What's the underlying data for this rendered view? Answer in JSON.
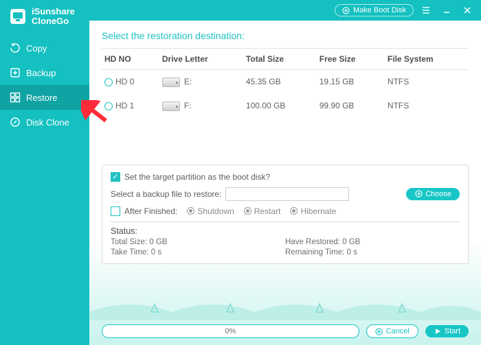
{
  "brand": {
    "line1": "iSunshare",
    "line2": "CloneGo"
  },
  "nav": {
    "copy": "Copy",
    "backup": "Backup",
    "restore": "Restore",
    "diskclone": "Disk Clone"
  },
  "titlebar": {
    "make_boot_disk": "Make Boot Disk"
  },
  "heading": "Select the restoration destination:",
  "table": {
    "headers": {
      "hdno": "HD NO",
      "letter": "Drive Letter",
      "total": "Total Size",
      "free": "Free Size",
      "fs": "File System"
    },
    "rows": [
      {
        "hdno": "HD 0",
        "letter": "E:",
        "total": "45.35 GB",
        "free": "19.15 GB",
        "fs": "NTFS"
      },
      {
        "hdno": "HD 1",
        "letter": "F:",
        "total": "100.00 GB",
        "free": "99.90 GB",
        "fs": "NTFS"
      }
    ]
  },
  "panel": {
    "target_boot_label": "Set the target partition as the boot disk?",
    "select_backup_label": "Select a backup file to restore:",
    "backup_path": "",
    "choose_label": "Choose",
    "after_finished_label": "After Finished:",
    "opts": {
      "shutdown": "Shutdown",
      "restart": "Restart",
      "hibernate": "Hibernate"
    },
    "status_title": "Status:",
    "total_size": "Total Size: 0 GB",
    "have_restored": "Have Restored: 0 GB",
    "take_time": "Take Time: 0 s",
    "remaining_time": "Remaining Time: 0 s"
  },
  "footer": {
    "progress_text": "0%",
    "cancel": "Cancel",
    "start": "Start"
  },
  "colors": {
    "accent": "#14c0c0"
  }
}
